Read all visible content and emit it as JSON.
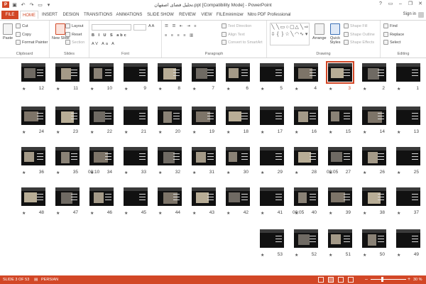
{
  "window": {
    "title": "تحلیل فضای اصفهان.ppt [Compatibility Mode] - PowerPoint",
    "controls": [
      "?",
      "▭",
      "–",
      "❐",
      "✕"
    ]
  },
  "tabs": [
    "FILE",
    "HOME",
    "INSERT",
    "DESIGN",
    "TRANSITIONS",
    "ANIMATIONS",
    "SLIDE SHOW",
    "REVIEW",
    "VIEW",
    "FILEminimizer",
    "Nitro PDF Professional"
  ],
  "signin": "Sign in",
  "ribbon": {
    "clipboard": {
      "paste": "Paste",
      "cut": "Cut",
      "copy": "Copy",
      "format_painter": "Format Painter",
      "label": "Clipboard"
    },
    "slides": {
      "new_slide": "New Slide",
      "layout": "Layout",
      "reset": "Reset",
      "section": "Section",
      "label": "Slides"
    },
    "font": {
      "label": "Font"
    },
    "paragraph": {
      "text_direction": "Text Direction",
      "align_text": "Align Text",
      "convert": "Convert to SmartArt",
      "label": "Paragraph"
    },
    "drawing": {
      "arrange": "Arrange",
      "quick_styles": "Quick Styles",
      "shape_fill": "Shape Fill",
      "shape_outline": "Shape Outline",
      "shape_effects": "Shape Effects",
      "label": "Drawing"
    },
    "editing": {
      "find": "Find",
      "replace": "Replace",
      "select": "Select",
      "label": "Editing"
    }
  },
  "slides": [
    {
      "n": "12"
    },
    {
      "n": "11"
    },
    {
      "n": "10"
    },
    {
      "n": "9"
    },
    {
      "n": "8"
    },
    {
      "n": "7"
    },
    {
      "n": "6"
    },
    {
      "n": "5"
    },
    {
      "n": "4"
    },
    {
      "n": "3",
      "selected": true
    },
    {
      "n": "2"
    },
    {
      "n": "1"
    },
    {
      "n": "24"
    },
    {
      "n": "23"
    },
    {
      "n": "22"
    },
    {
      "n": "21"
    },
    {
      "n": "20"
    },
    {
      "n": "19"
    },
    {
      "n": "18"
    },
    {
      "n": "17"
    },
    {
      "n": "16"
    },
    {
      "n": "15"
    },
    {
      "n": "14"
    },
    {
      "n": "13"
    },
    {
      "n": "36"
    },
    {
      "n": "35"
    },
    {
      "n": "34",
      "duration": "00:10"
    },
    {
      "n": "33"
    },
    {
      "n": "32"
    },
    {
      "n": "31"
    },
    {
      "n": "30"
    },
    {
      "n": "29"
    },
    {
      "n": "28"
    },
    {
      "n": "27",
      "duration": "00:05"
    },
    {
      "n": "26"
    },
    {
      "n": "25"
    },
    {
      "n": "48"
    },
    {
      "n": "47"
    },
    {
      "n": "46"
    },
    {
      "n": "45"
    },
    {
      "n": "44"
    },
    {
      "n": "43"
    },
    {
      "n": "42"
    },
    {
      "n": "41"
    },
    {
      "n": "40",
      "duration": "00:05"
    },
    {
      "n": "39"
    },
    {
      "n": "38"
    },
    {
      "n": "37"
    },
    {
      "n": "53"
    },
    {
      "n": "52"
    },
    {
      "n": "51"
    },
    {
      "n": "50"
    },
    {
      "n": "49"
    }
  ],
  "status": {
    "slide_info": "SLIDE 3 OF 53",
    "language": "PERSIAN",
    "zoom": "30 %",
    "zoom_fraction": 0.3,
    "accent": "#d24726"
  }
}
